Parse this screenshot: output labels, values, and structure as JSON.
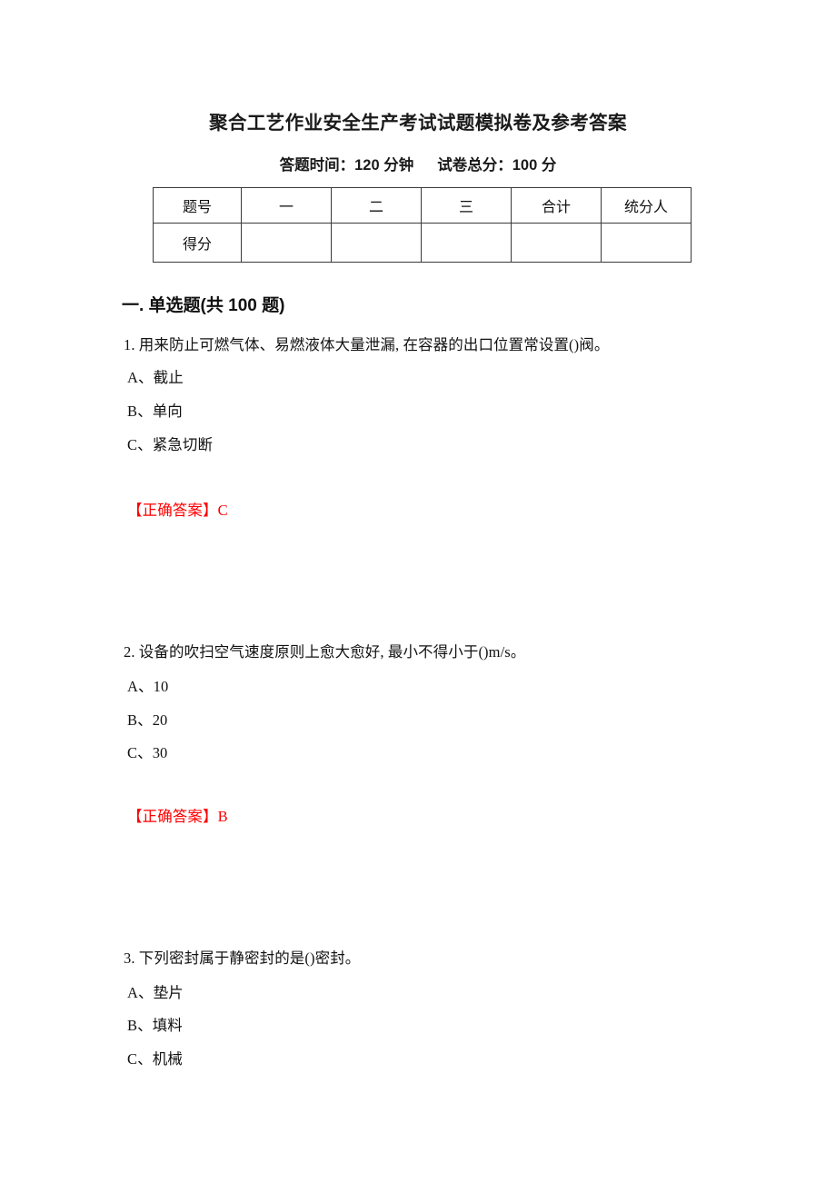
{
  "document": {
    "title": "聚合工艺作业安全生产考试试题模拟卷及参考答案",
    "subtitle_time": "答题时间：120 分钟",
    "subtitle_total": "试卷总分：100 分"
  },
  "score_table": {
    "row_header_label": "题号",
    "row_score_label": "得分",
    "columns": [
      "一",
      "二",
      "三",
      "合计",
      "统分人"
    ],
    "score_values": [
      "",
      "",
      "",
      "",
      ""
    ]
  },
  "section": {
    "heading": "一. 单选题(共 100 题)"
  },
  "questions": [
    {
      "stem": "1. 用来防止可燃气体、易燃液体大量泄漏, 在容器的出口位置常设置()阀。",
      "options": [
        "A、截止",
        "B、单向",
        "C、紧急切断"
      ],
      "answer": "【正确答案】C"
    },
    {
      "stem": "2. 设备的吹扫空气速度原则上愈大愈好, 最小不得小于()m/s。",
      "options": [
        "A、10",
        "B、20",
        "C、30"
      ],
      "answer": "【正确答案】B"
    },
    {
      "stem": "3. 下列密封属于静密封的是()密封。",
      "options": [
        "A、垫片",
        "B、填料",
        "C、机械"
      ],
      "answer": ""
    }
  ],
  "colors": {
    "answer_red": "#ff0000",
    "text_black": "#121212",
    "table_border": "#3a3a3a"
  }
}
